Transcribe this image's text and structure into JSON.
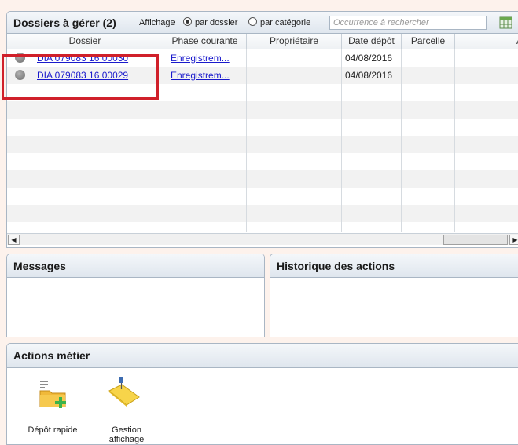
{
  "dossiers_panel": {
    "title": "Dossiers à gérer (2)",
    "affichage_label": "Affichage",
    "radio_par_dossier": "par dossier",
    "radio_par_categorie": "par catégorie",
    "search_placeholder": "Occurrence à rechercher",
    "columns": [
      "Dossier",
      "Phase courante",
      "Propriétaire",
      "Date dépôt",
      "Parcelle",
      "A"
    ],
    "rows": [
      {
        "dossier": "DIA 079083 16 00030",
        "phase": "Enregistrem...",
        "proprietaire": "",
        "date": "04/08/2016",
        "parcelle": ""
      },
      {
        "dossier": "DIA 079083 16 00029",
        "phase": "Enregistrem...",
        "proprietaire": "",
        "date": "04/08/2016",
        "parcelle": ""
      }
    ]
  },
  "messages_panel": {
    "title": "Messages"
  },
  "historique_panel": {
    "title": "Historique des actions"
  },
  "actions_panel": {
    "title": "Actions métier",
    "actions": [
      {
        "label": "Dépôt rapide",
        "icon": "folder-add-icon"
      },
      {
        "label": "Gestion affichage",
        "icon": "folder-pin-icon"
      }
    ]
  },
  "colors": {
    "highlight": "#d0202a",
    "link": "#1a1acc",
    "panel_border": "#a9b6c4"
  }
}
